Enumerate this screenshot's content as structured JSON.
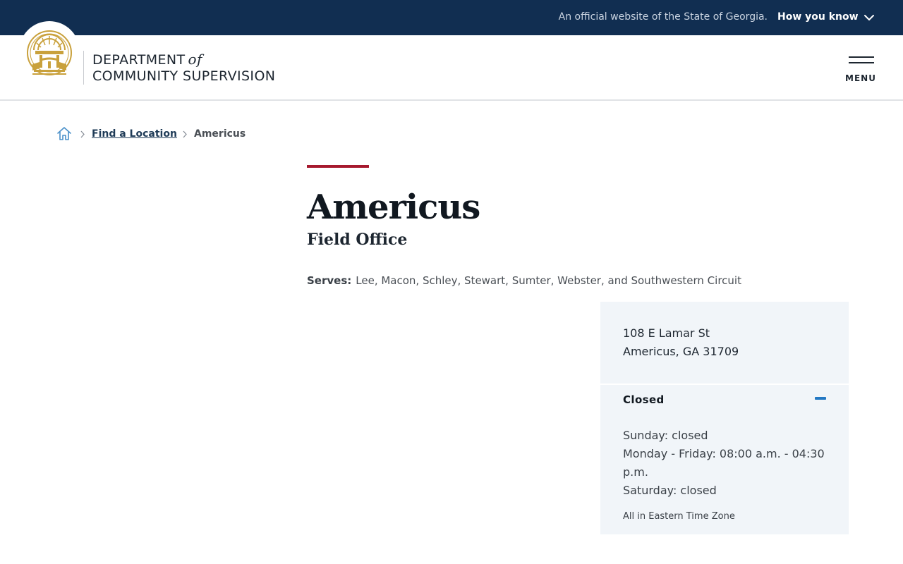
{
  "banner": {
    "official_text": "An official website of the State of Georgia.",
    "how_you_know": "How you know",
    "chevron_icon": "chevron-down-icon",
    "background": "#112e51"
  },
  "header": {
    "seal_icon": "georgia-seal-icon",
    "dept_word": "DEPARTMENT",
    "dept_of": "of",
    "dept_line2": "COMMUNITY SUPERVISION",
    "menu_label": "MENU",
    "menu_icon": "hamburger-icon"
  },
  "breadcrumb": {
    "home_icon": "home-icon",
    "separator_icon": "chevron-right-icon",
    "link": "Find a Location",
    "current": "Americus"
  },
  "office": {
    "title": "Americus",
    "type": "Field Office",
    "serves_label": "Serves:",
    "serves_value": "Lee, Macon, Schley, Stewart, Sumter, Webster, and Southwestern Circuit",
    "accent_color": "#a6192e"
  },
  "card": {
    "address_line1": "108 E Lamar St",
    "address_line2": "Americus, GA 31709",
    "status": "Closed",
    "collapse_icon": "minus-icon",
    "hours": [
      "Sunday: closed",
      "Monday - Friday: 08:00 a.m. - 04:30",
      "p.m.",
      "Saturday: closed"
    ],
    "timezone_note": "All in Eastern Time Zone"
  }
}
